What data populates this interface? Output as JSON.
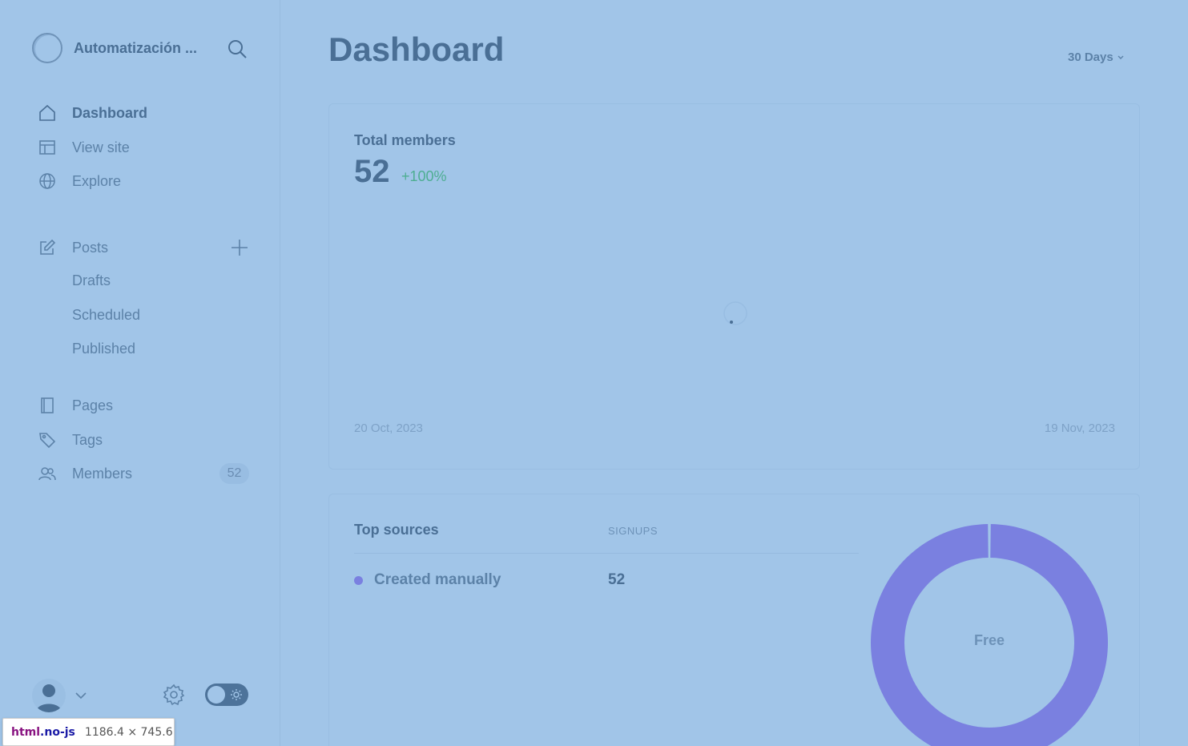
{
  "sidebar": {
    "brand_title": "Automatización ...",
    "nav": [
      {
        "label": "Dashboard",
        "icon": "home-icon",
        "active": true
      },
      {
        "label": "View site",
        "icon": "layout-icon"
      },
      {
        "label": "Explore",
        "icon": "globe-icon"
      }
    ],
    "posts": {
      "label": "Posts",
      "icon": "edit-icon",
      "sub_items": [
        "Drafts",
        "Scheduled",
        "Published"
      ]
    },
    "pages_label": "Pages",
    "tags_label": "Tags",
    "members_label": "Members",
    "members_count": "52"
  },
  "header": {
    "title": "Dashboard",
    "range": "30 Days"
  },
  "members_card": {
    "label": "Total members",
    "value": "52",
    "change": "+100%",
    "date_start": "20 Oct, 2023",
    "date_end": "19 Nov, 2023"
  },
  "sources_card": {
    "label": "Top sources",
    "column_header": "SIGNUPS",
    "rows": [
      {
        "name": "Created manually",
        "count": "52"
      }
    ],
    "donut_label": "Free"
  },
  "chart_data": {
    "type": "pie",
    "categories": [
      "Created manually"
    ],
    "values": [
      52
    ],
    "title": "",
    "center_label": "Free"
  },
  "devtools_tooltip": {
    "tag": "html",
    "cls": ".no-js",
    "dims": "1186.4 × 745.6"
  },
  "colors": {
    "background": "#a1c5e8",
    "accent_purple": "#7a80e0",
    "positive_green": "#4eae92",
    "text_primary": "#4a6f95"
  }
}
